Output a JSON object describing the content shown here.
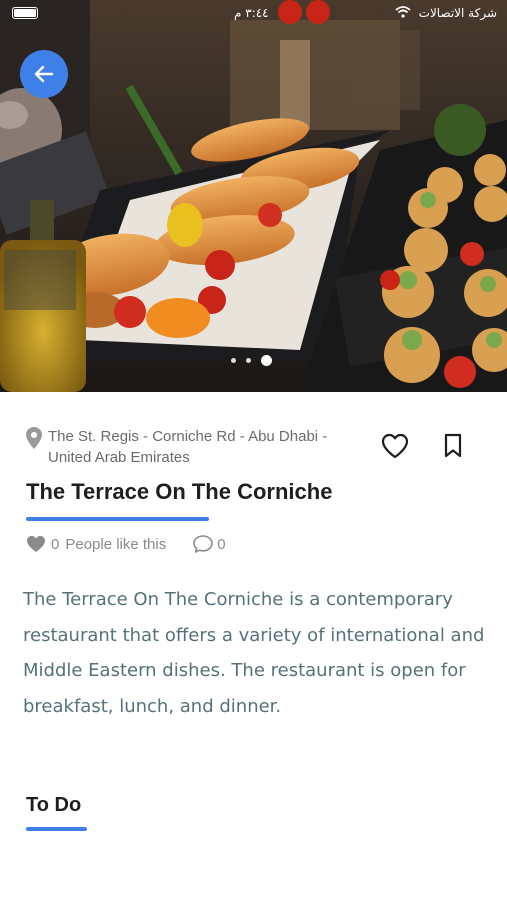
{
  "status_bar": {
    "time": "٣:٤٤ م",
    "carrier": "شركة الاتصالات"
  },
  "header": {
    "back_icon": "arrow-left-icon",
    "carousel": {
      "count": 3,
      "active_index": 2
    }
  },
  "place": {
    "address": "The St. Regis - Corniche Rd - Abu Dhabi - United Arab Emirates",
    "name": "The Terrace On The Corniche",
    "likes_count": "0",
    "likes_label": "People like this",
    "comments_count": "0",
    "description": "The Terrace On The Corniche is a contemporary restaurant that offers a variety of international and Middle Eastern dishes. The restaurant is open for breakfast, lunch, and dinner."
  },
  "sections": {
    "todo_title": "To Do"
  },
  "colors": {
    "accent": "#3f7fe8",
    "description_text": "#55727a"
  }
}
